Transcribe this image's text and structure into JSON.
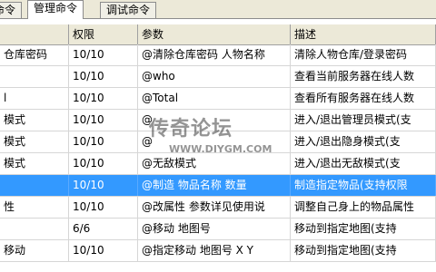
{
  "tabs": [
    {
      "label": "命令"
    },
    {
      "label": "管理命令"
    },
    {
      "label": "调试命令"
    }
  ],
  "table": {
    "columns": [
      "",
      "权限",
      "参数",
      "描述"
    ],
    "rows": [
      {
        "name": "仓库密码",
        "perm": "10/10",
        "param": "@清除仓库密码 人物名称",
        "desc": "清除人物仓库/登录密码"
      },
      {
        "name": "",
        "perm": "10/10",
        "param": "@who",
        "desc": "查看当前服务器在线人数"
      },
      {
        "name": "l",
        "perm": "10/10",
        "param": "@Total",
        "desc": "查看所有服务器在线人数"
      },
      {
        "name": "模式",
        "perm": "10/10",
        "param": "@",
        "desc": "进入/退出管理员模式(支"
      },
      {
        "name": "模式",
        "perm": "10/10",
        "param": "@",
        "desc": "进入/退出隐身模式(支"
      },
      {
        "name": "模式",
        "perm": "10/10",
        "param": "@无敌模式",
        "desc": "进入/退出无敌模式(支"
      },
      {
        "name": "",
        "perm": "10/10",
        "param": "@制造 物品名称 数量",
        "desc": "制造指定物品(支持权限"
      },
      {
        "name": "性",
        "perm": "10/10",
        "param": "@改属性 参数详见使用说",
        "desc": "调整自己身上的物品属性"
      },
      {
        "name": "",
        "perm": "6/6",
        "param": "@移动 地图号",
        "desc": "移动到指定地图(支持"
      },
      {
        "name": "移动",
        "perm": "10/10",
        "param": "@指定移动 地图号 X Y",
        "desc": "移动到指定地图(支持"
      }
    ],
    "selected_row": 6
  },
  "watermark": {
    "title": "传奇论坛",
    "url": "WWW.DIYGM.COM"
  }
}
